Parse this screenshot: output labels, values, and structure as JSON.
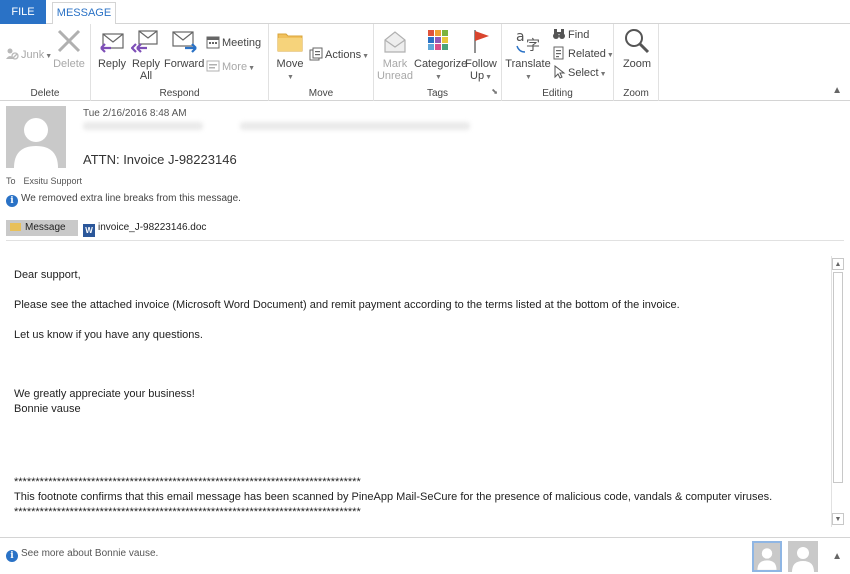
{
  "tabs": {
    "file": "FILE",
    "message": "MESSAGE"
  },
  "ribbon": {
    "delete_group": {
      "label": "Delete",
      "junk": "Junk",
      "delete": "Delete"
    },
    "respond_group": {
      "label": "Respond",
      "reply": "Reply",
      "reply_all_1": "Reply",
      "reply_all_2": "All",
      "forward": "Forward",
      "meeting": "Meeting",
      "more": "More"
    },
    "move_group": {
      "label": "Move",
      "move": "Move",
      "actions": "Actions"
    },
    "tags_group": {
      "label": "Tags",
      "mark_unread_1": "Mark",
      "mark_unread_2": "Unread",
      "categorize": "Categorize",
      "follow_up_1": "Follow",
      "follow_up_2": "Up"
    },
    "editing_group": {
      "label": "Editing",
      "translate": "Translate",
      "find": "Find",
      "related": "Related",
      "select": "Select"
    },
    "zoom_group": {
      "label": "Zoom",
      "zoom": "Zoom"
    }
  },
  "header": {
    "date": "Tue 2/16/2016 8:48 AM",
    "subject": "ATTN: Invoice J-98223146",
    "to_label": "To",
    "to_value": "Exsitu Support",
    "info": "We removed extra line breaks from this message.",
    "message_tab": "Message",
    "attachment": "invoice_J-98223146.doc"
  },
  "body": {
    "greeting": "Dear support,",
    "line1": "Please see the attached invoice (Microsoft Word Document) and remit payment according to the terms listed at the bottom of the invoice.",
    "line2": "Let us know if you have any questions.",
    "line3": "We greatly appreciate your business!",
    "line4": "Bonnie vause",
    "stars": "*********************************************************************************",
    "footnote": "This footnote confirms that this email message has been scanned by PineApp Mail-SeCure for the presence of malicious code, vandals & computer viruses."
  },
  "footer": {
    "text": "See more about Bonnie vause."
  }
}
